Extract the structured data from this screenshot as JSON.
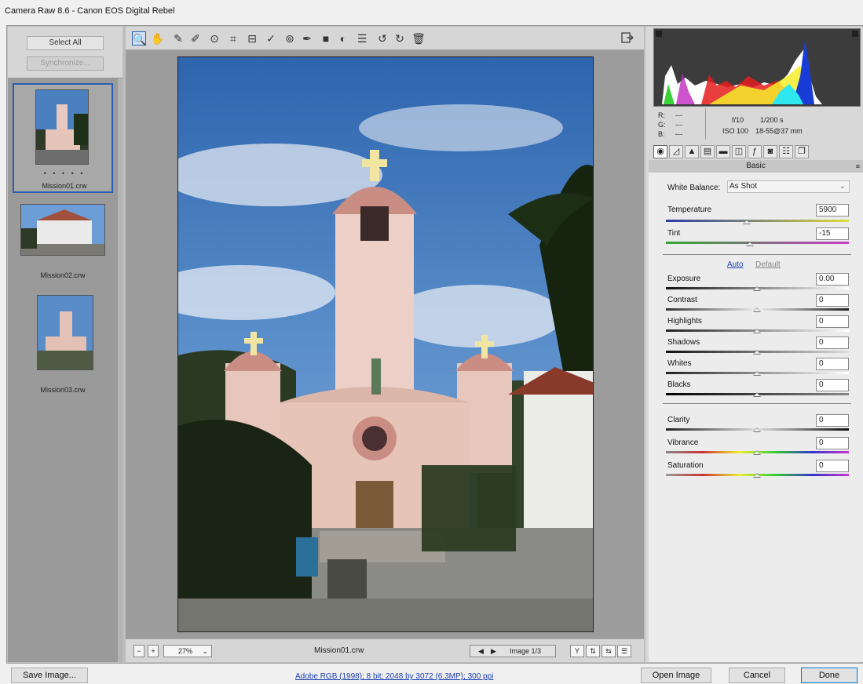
{
  "window": {
    "title": "Camera Raw 8.6 -  Canon EOS Digital Rebel"
  },
  "filmstrip": {
    "select_all": "Select All",
    "synchronize": "Synchronize...",
    "rating_dots": "• • • • •",
    "items": [
      {
        "label": "Mission01.crw",
        "selected": true
      },
      {
        "label": "Mission02.crw",
        "selected": false
      },
      {
        "label": "Mission03.crw",
        "selected": false
      }
    ]
  },
  "toolbar": {
    "tools": [
      "zoom-icon",
      "hand-icon",
      "white-balance-icon",
      "color-sampler-icon",
      "targeted-adjustment-icon",
      "crop-icon",
      "straighten-icon",
      "spot-removal-icon",
      "red-eye-icon",
      "adjustment-brush-icon",
      "graduated-filter-icon",
      "radial-filter-icon",
      "preferences-icon",
      "rotate-ccw-icon",
      "rotate-cw-icon",
      "trash-icon"
    ],
    "glyphs": [
      "🔍",
      "✋",
      "✎",
      "✐",
      "⊙",
      "⌗",
      "⊟",
      "✓",
      "⊚",
      "✒",
      "■",
      "◐",
      "☰",
      "↺",
      "↻",
      "🗑"
    ]
  },
  "preview": {
    "zoom": "27%",
    "filename": "Mission01.crw",
    "image_counter": "Image 1/3"
  },
  "info": {
    "r_label": "R:",
    "g_label": "G:",
    "b_label": "B:",
    "r_value": "---",
    "g_value": "---",
    "b_value": "---",
    "aperture": "f/10",
    "shutter": "1/200 s",
    "iso": "ISO 100",
    "lens": "18-55@37 mm"
  },
  "panel": {
    "title": "Basic",
    "white_balance_label": "White Balance:",
    "white_balance_value": "As Shot",
    "temperature_label": "Temperature",
    "temperature_value": "5900",
    "temperature_level": 0.44,
    "tint_label": "Tint",
    "tint_value": "-15",
    "tint_level": 0.46,
    "auto_label": "Auto",
    "default_label": "Default",
    "sliders": [
      {
        "label": "Exposure",
        "value": "0.00"
      },
      {
        "label": "Contrast",
        "value": "0"
      },
      {
        "label": "Highlights",
        "value": "0"
      },
      {
        "label": "Shadows",
        "value": "0"
      },
      {
        "label": "Whites",
        "value": "0"
      },
      {
        "label": "Blacks",
        "value": "0"
      }
    ],
    "presence": [
      {
        "label": "Clarity",
        "value": "0"
      },
      {
        "label": "Vibrance",
        "value": "0"
      },
      {
        "label": "Saturation",
        "value": "0"
      }
    ]
  },
  "bottom": {
    "save_image": "Save Image...",
    "workflow": "Adobe RGB (1998); 8 bit; 2048 by 3072 (6.3MP); 300 ppi",
    "open_image": "Open Image",
    "cancel": "Cancel",
    "done": "Done"
  },
  "colors": {
    "accent": "#2a5fb0",
    "link": "#1a3fb3"
  }
}
